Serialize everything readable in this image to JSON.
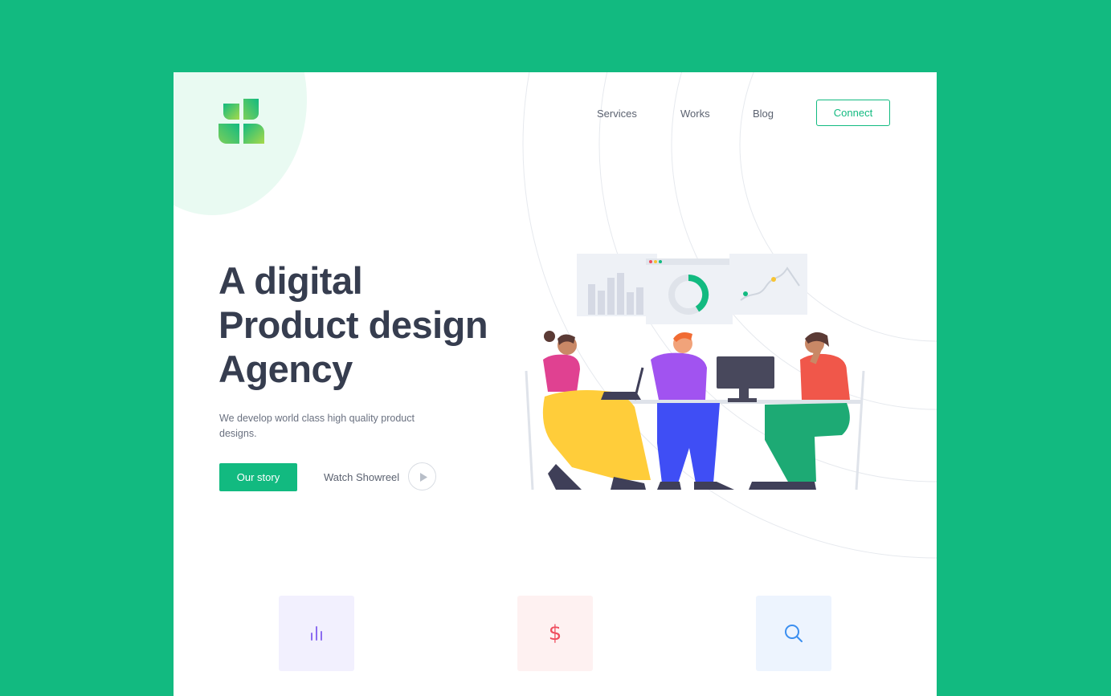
{
  "header": {
    "logo_icon": "leaf-logo-icon",
    "nav": [
      {
        "label": "Services"
      },
      {
        "label": "Works"
      },
      {
        "label": "Blog"
      }
    ],
    "cta_label": "Connect"
  },
  "hero": {
    "title_lines": [
      "A digital",
      "Product design",
      "Agency"
    ],
    "subtitle": "We develop world class high quality product designs.",
    "primary_button": "Our story",
    "secondary_label": "Watch Showreel",
    "play_icon": "play-icon",
    "illustration": "team-at-desk-illustration"
  },
  "features": [
    {
      "icon": "bar-chart-icon",
      "color": "#8b6cf0"
    },
    {
      "icon": "dollar-icon",
      "color": "#ef4d5e"
    },
    {
      "icon": "search-icon",
      "color": "#3b8ff0"
    }
  ],
  "colors": {
    "background": "#12ba80",
    "accent": "#12ba80",
    "heading": "#363d4f",
    "card": "#ffffff"
  }
}
